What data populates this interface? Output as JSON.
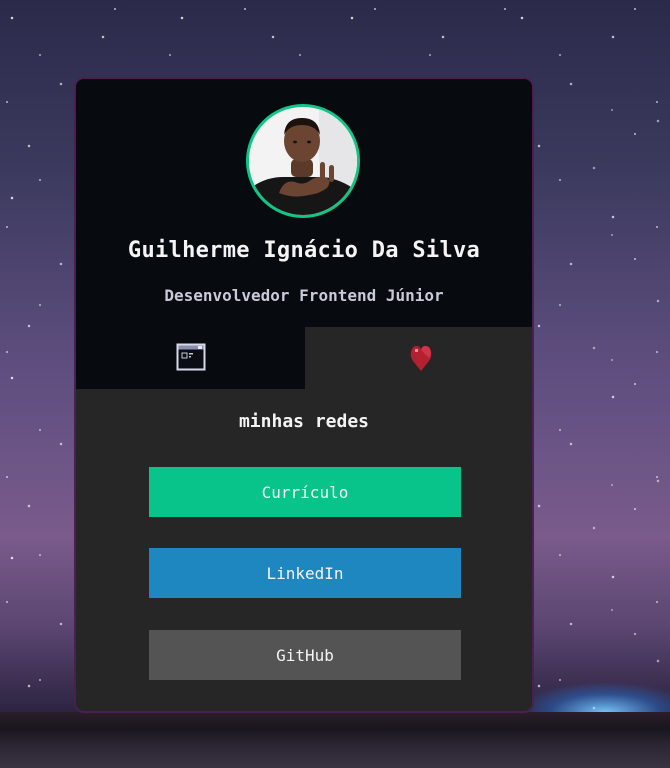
{
  "profile": {
    "name": "Guilherme Ignácio Da Silva",
    "role": "Desenvolvedor Frontend Júnior"
  },
  "tabs": [
    {
      "icon": "browser-window-icon",
      "active": false
    },
    {
      "icon": "heart-icon",
      "active": true
    }
  ],
  "links_section": {
    "title": "minhas redes",
    "buttons": [
      {
        "label": "Currículo",
        "color": "#08c48a"
      },
      {
        "label": "LinkedIn",
        "color": "#1e87c0"
      },
      {
        "label": "GitHub",
        "color": "#545454"
      }
    ]
  },
  "colors": {
    "avatar_border": "#10c585",
    "card_border": "#4a1f52",
    "header_bg": "#070b10",
    "panel_bg": "#262626",
    "heart": "#c0243a"
  }
}
